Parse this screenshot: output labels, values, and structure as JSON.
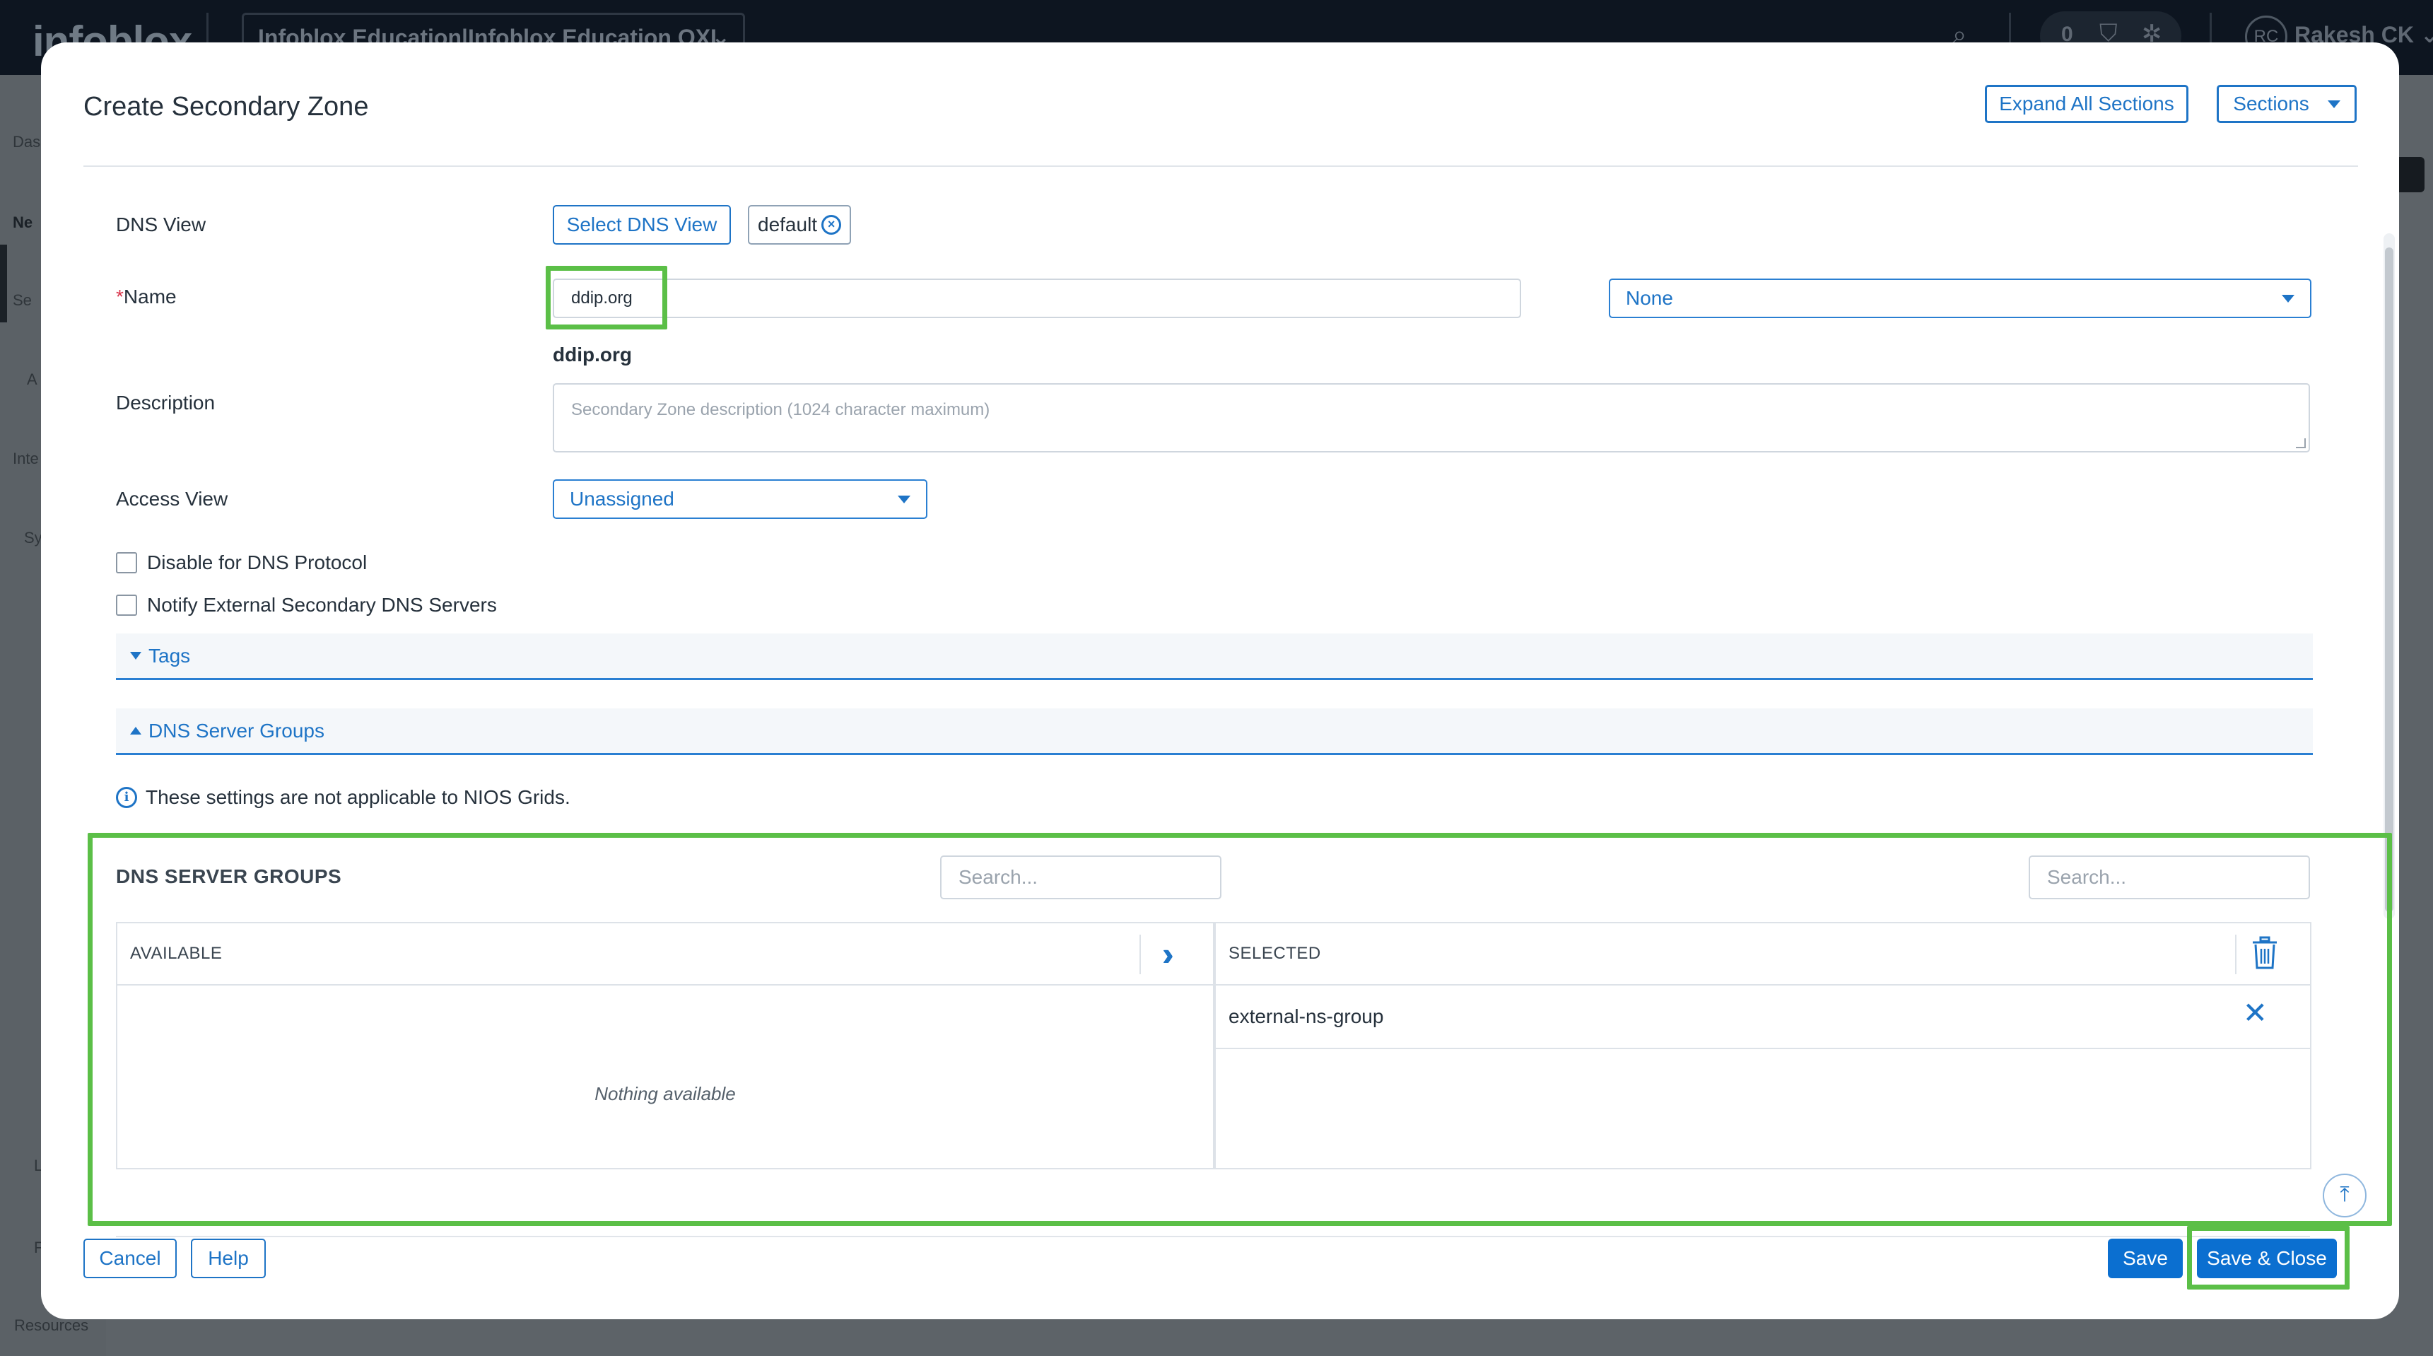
{
  "app": {
    "logo": "infoblox",
    "tenant": "Infoblox Education|Infoblox Education OXL",
    "notification_count": "0",
    "user_initials": "RC",
    "user_name": "Rakesh CK",
    "sidebar_items": [
      "Das",
      "Ne",
      "Se",
      "A",
      "Inte",
      "Sy",
      "L",
      "F"
    ],
    "resources_label": "Resources"
  },
  "modal": {
    "title": "Create Secondary Zone",
    "expand_all_label": "Expand All Sections",
    "sections_label": "Sections",
    "dns_view": {
      "label": "DNS View",
      "select_button": "Select DNS View",
      "chip_value": "default"
    },
    "name": {
      "required_mark": "*",
      "label": "Name",
      "value": "ddip.org",
      "suffix_select": "None",
      "echo": "ddip.org"
    },
    "description": {
      "label": "Description",
      "placeholder": "Secondary Zone description (1024 character maximum)"
    },
    "access_view": {
      "label": "Access View",
      "value": "Unassigned"
    },
    "checkboxes": {
      "disable_dns": "Disable for DNS Protocol",
      "notify_external": "Notify External Secondary DNS Servers"
    },
    "sections": {
      "tags": "Tags",
      "dns_server_groups": "DNS Server Groups"
    },
    "note": "These settings are not applicable to NIOS Grids.",
    "server_groups": {
      "title": "DNS SERVER GROUPS",
      "search_placeholder": "Search...",
      "available_header": "AVAILABLE",
      "selected_header": "SELECTED",
      "empty_text": "Nothing available",
      "selected_items": [
        "external-ns-group"
      ]
    },
    "footer": {
      "cancel": "Cancel",
      "help": "Help",
      "save": "Save",
      "save_close": "Save & Close"
    }
  },
  "colors": {
    "accent": "#1e74c6",
    "primary_button": "#0b6fd0",
    "highlight": "#5bbf47",
    "required": "#d9364c"
  }
}
